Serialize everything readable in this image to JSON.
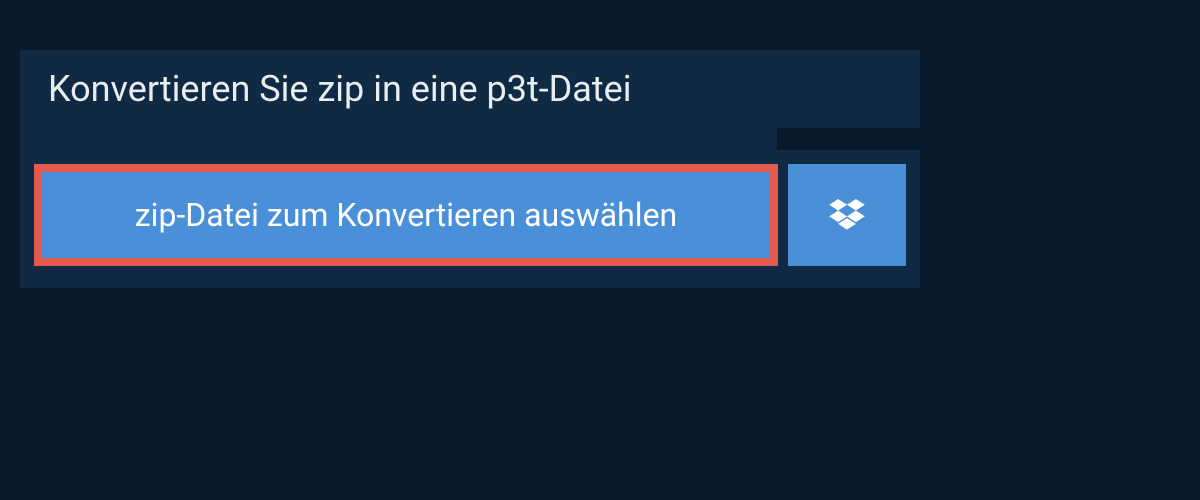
{
  "header": {
    "title": "Konvertieren Sie zip in eine p3t-Datei"
  },
  "buttons": {
    "select_file_label": "zip-Datei zum Konvertieren auswählen"
  },
  "colors": {
    "page_bg": "#0a1a2a",
    "panel_bg": "#102a43",
    "button_bg": "#4a90d9",
    "highlight_border": "#e35a4f",
    "text_light": "#e8edf2",
    "text_white": "#ffffff"
  }
}
